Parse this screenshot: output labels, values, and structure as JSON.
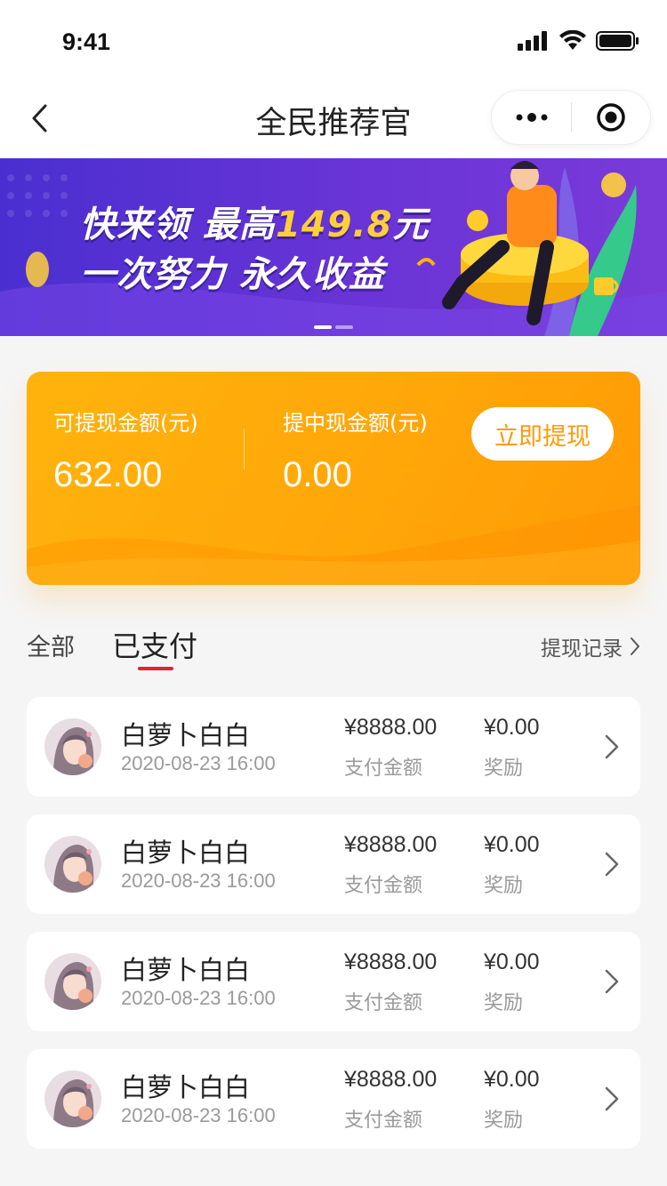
{
  "status_bar": {
    "time": "9:41"
  },
  "nav": {
    "title": "全民推荐官",
    "back_icon": "chevron-left-icon",
    "more_icon": "more-dots-icon",
    "close_icon": "target-close-icon"
  },
  "banner": {
    "line1_prefix": "快来领 最高",
    "line1_amount": "149.8",
    "line1_suffix": "元",
    "line2": "一次努力 永久收益",
    "page_count": 2,
    "active_page": 1
  },
  "wallet": {
    "available_label": "可提现金额(元)",
    "available_value": "632.00",
    "pending_label": "提中现金额(元)",
    "pending_value": "0.00",
    "withdraw_button": "立即提现"
  },
  "tabs": {
    "items": [
      {
        "label": "全部",
        "active": false
      },
      {
        "label": "已支付",
        "active": true
      }
    ],
    "records_link": "提现记录"
  },
  "list": {
    "items": [
      {
        "name": "白萝卜白白",
        "time": "2020-08-23 16:00",
        "pay_value": "¥8888.00",
        "pay_label": "支付金额",
        "reward_value": "¥0.00",
        "reward_label": "奖励"
      },
      {
        "name": "白萝卜白白",
        "time": "2020-08-23 16:00",
        "pay_value": "¥8888.00",
        "pay_label": "支付金额",
        "reward_value": "¥0.00",
        "reward_label": "奖励"
      },
      {
        "name": "白萝卜白白",
        "time": "2020-08-23 16:00",
        "pay_value": "¥8888.00",
        "pay_label": "支付金额",
        "reward_value": "¥0.00",
        "reward_label": "奖励"
      },
      {
        "name": "白萝卜白白",
        "time": "2020-08-23 16:00",
        "pay_value": "¥8888.00",
        "pay_label": "支付金额",
        "reward_value": "¥0.00",
        "reward_label": "奖励"
      }
    ]
  },
  "colors": {
    "accent_orange": "#ffa80a",
    "tab_underline": "#e4232a",
    "banner_purple": "#5a32d4"
  }
}
